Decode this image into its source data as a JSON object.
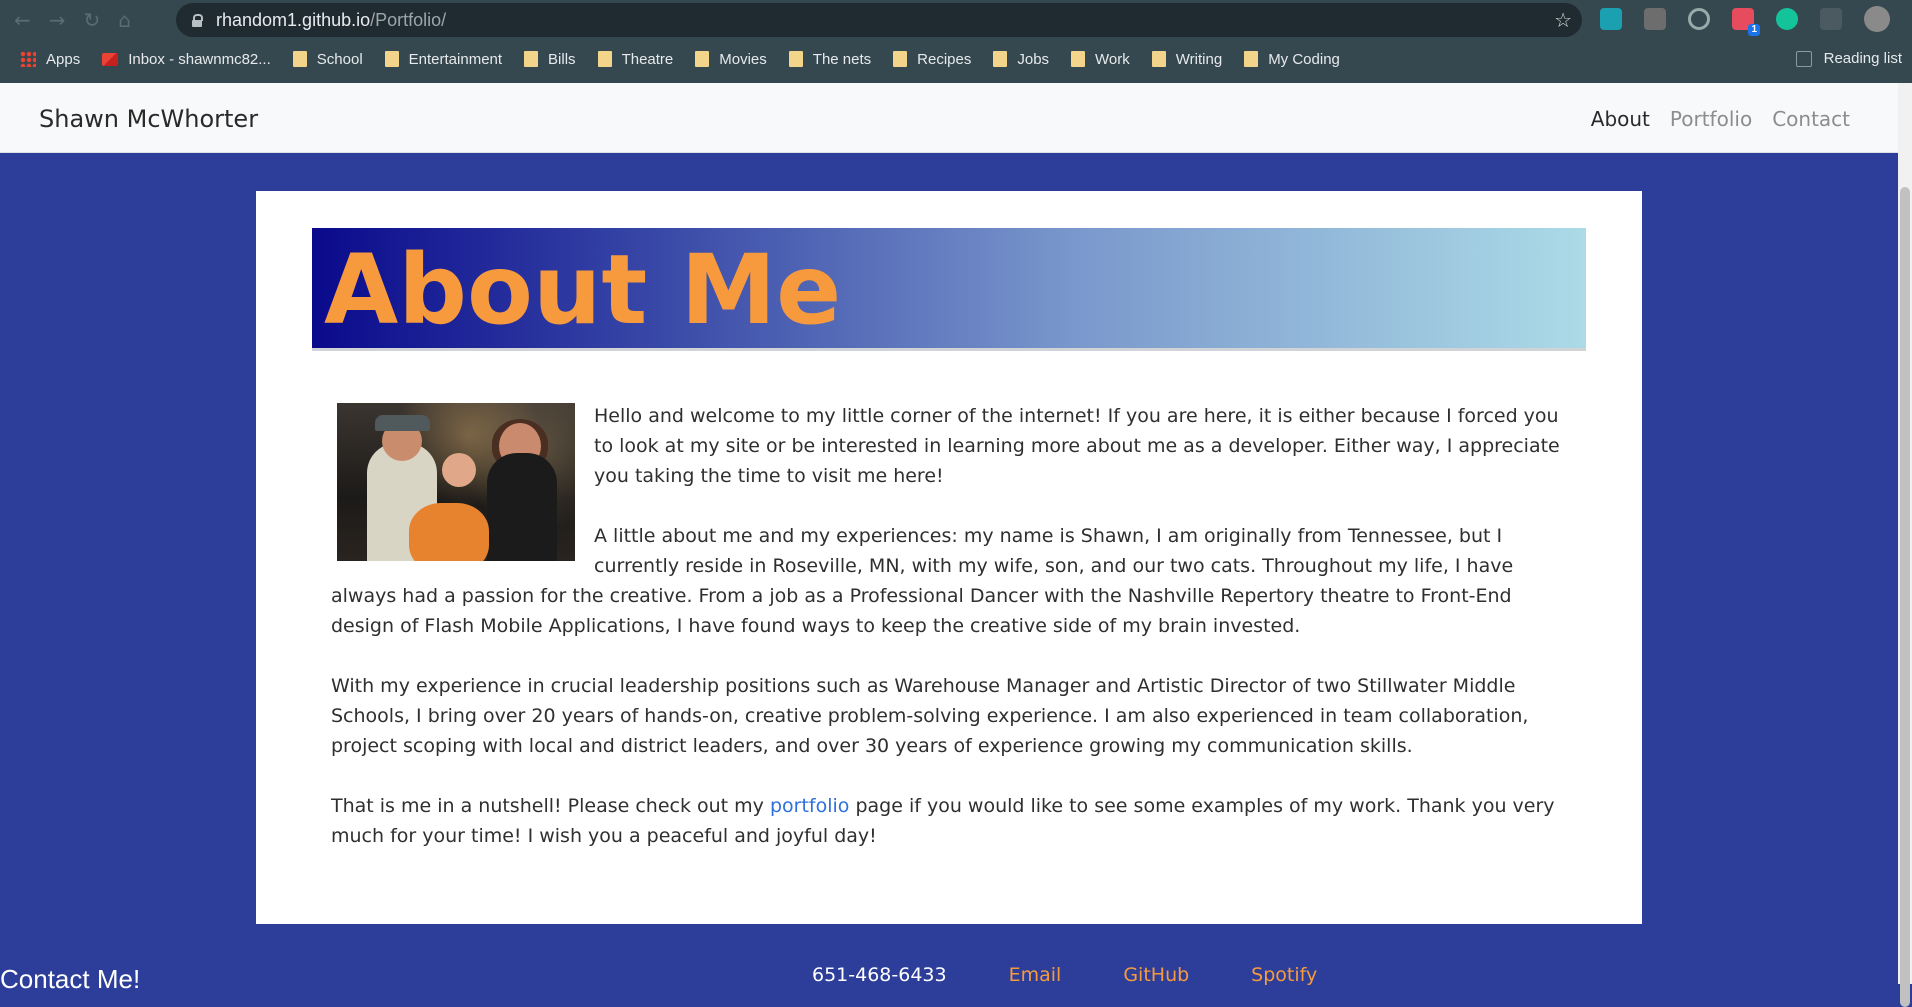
{
  "browser": {
    "url_host": "rhandom1.github.io",
    "url_path": "/Portfolio/",
    "bookmarks": [
      {
        "label": "Apps",
        "icon": "apps-grid-icon"
      },
      {
        "label": "Inbox - shawnmc82...",
        "icon": "gmail-icon"
      },
      {
        "label": "School",
        "icon": "folder-icon"
      },
      {
        "label": "Entertainment",
        "icon": "folder-icon"
      },
      {
        "label": "Bills",
        "icon": "folder-icon"
      },
      {
        "label": "Theatre",
        "icon": "folder-icon"
      },
      {
        "label": "Movies",
        "icon": "folder-icon"
      },
      {
        "label": "The nets",
        "icon": "folder-icon"
      },
      {
        "label": "Recipes",
        "icon": "folder-icon"
      },
      {
        "label": "Jobs",
        "icon": "folder-icon"
      },
      {
        "label": "Work",
        "icon": "folder-icon"
      },
      {
        "label": "Writing",
        "icon": "folder-icon"
      },
      {
        "label": "My Coding",
        "icon": "folder-icon"
      }
    ],
    "reading_list": "Reading list",
    "extension_badge": "1"
  },
  "navbar": {
    "brand": "Shawn McWhorter",
    "links": [
      {
        "label": "About",
        "active": true
      },
      {
        "label": "Portfolio",
        "active": false
      },
      {
        "label": "Contact",
        "active": false
      }
    ]
  },
  "about": {
    "heading": "About Me",
    "p1": "Hello and welcome to my little corner of the internet! If you are here, it is either because I forced you to look at my site or be interested in learning more about me as a developer. Either way, I appreciate you taking the time to visit me here!",
    "p2": "A little about me and my experiences: my name is Shawn, I am originally from Tennessee, but I currently reside in Roseville, MN, with my wife, son, and our two cats. Throughout my life, I have always had a passion for the creative. From a job as a Professional Dancer with the Nashville Repertory theatre to Front-End design of Flash Mobile Applications, I have found ways to keep the creative side of my brain invested.",
    "p3": "With my experience in crucial leadership positions such as Warehouse Manager and Artistic Director of two Stillwater Middle Schools, I bring over 20 years of hands-on, creative problem-solving experience. I am also experienced in team collaboration, project scoping with local and district leaders, and over 30 years of experience growing my communication skills.",
    "p4_before": "That is me in a nutshell! Please check out my ",
    "p4_link": "portfolio",
    "p4_after": " page if you would like to see some examples of my work. Thank you very much for your time! I wish you a peaceful and joyful day!"
  },
  "footer": {
    "title": "Contact Me!",
    "phone": "651-468-6433",
    "links": [
      "Email",
      "GitHub",
      "Spotify"
    ]
  },
  "colors": {
    "page_bg": "#2c3e99",
    "heading_orange": "#f79a3e",
    "link_blue": "#2f6fdb"
  }
}
